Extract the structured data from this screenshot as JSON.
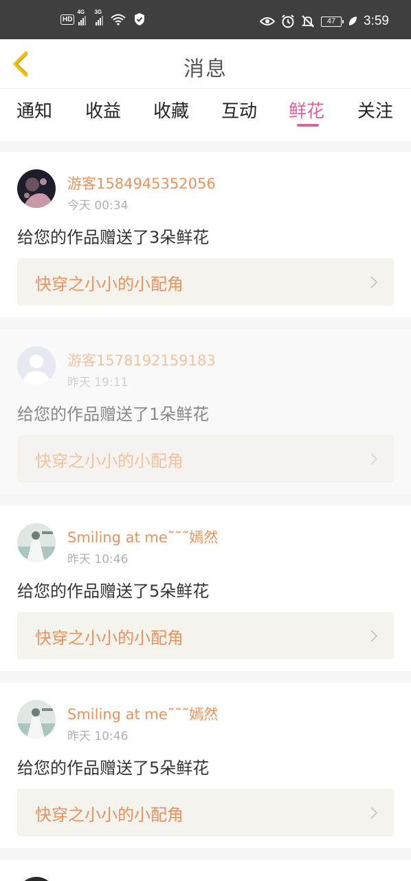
{
  "status_bar": {
    "hd": "HD",
    "sim1_net": "4G",
    "sim2_net": "3G",
    "battery": "47",
    "time": "3:59",
    "icons": [
      "eye-icon",
      "alarm-icon",
      "bell-off-icon",
      "battery-icon",
      "leaf-icon"
    ]
  },
  "header": {
    "title": "消息",
    "back_icon": "chevron-left-icon",
    "accent_color": "#f2c200"
  },
  "tabs": [
    {
      "label": "通知",
      "active": false
    },
    {
      "label": "收益",
      "active": false
    },
    {
      "label": "收藏",
      "active": false
    },
    {
      "label": "互动",
      "active": false
    },
    {
      "label": "鲜花",
      "active": true
    },
    {
      "label": "关注",
      "active": false
    }
  ],
  "active_tab_color": "#e0609a",
  "name_color": "#e8925c",
  "messages": [
    {
      "username": "游客1584945352056",
      "time": "今天 00:34",
      "text": "给您的作品赠送了3朵鲜花",
      "work": "快穿之小小的小配角",
      "read": false
    },
    {
      "username": "游客1578192159183",
      "time": "昨天 19:11",
      "text": "给您的作品赠送了1朵鲜花",
      "work": "快穿之小小的小配角",
      "read": true
    },
    {
      "username": "Smiling at me˜˜˜嫣然",
      "time": "昨天 10:46",
      "text": "给您的作品赠送了5朵鲜花",
      "work": "快穿之小小的小配角",
      "read": false
    },
    {
      "username": "Smiling at me˜˜˜嫣然",
      "time": "昨天 10:46",
      "text": "给您的作品赠送了5朵鲜花",
      "work": "快穿之小小的小配角",
      "read": false
    }
  ]
}
